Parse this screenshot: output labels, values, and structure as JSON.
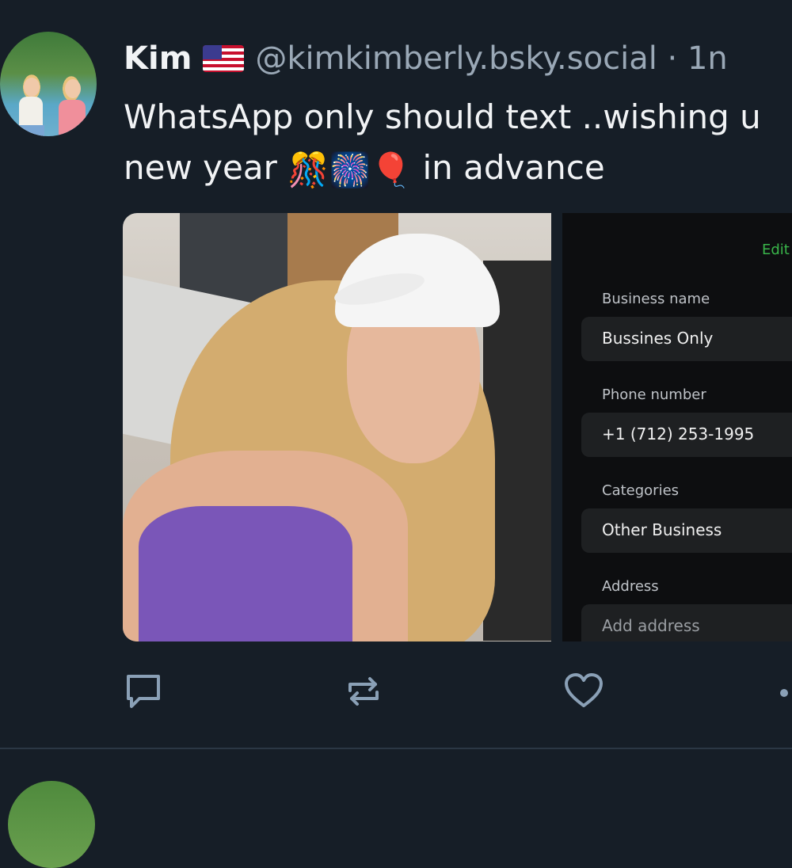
{
  "post": {
    "author_name": "Kim",
    "handle": "@kimkimberly.bsky.social",
    "time": "· 1n",
    "text_line1": "WhatsApp only should text ..wishing u",
    "text_line2_start": "new year",
    "emojis": [
      "🎊",
      "🎆",
      "🎈"
    ],
    "text_line2_end": "in advance"
  },
  "screenshot": {
    "edit_label": "Edit",
    "fields": [
      {
        "label": "Business name",
        "value": "Bussines Only"
      },
      {
        "label": "Phone number",
        "value": "+1 (712) 253-1995"
      },
      {
        "label": "Categories",
        "value": "Other Business"
      },
      {
        "label": "Address",
        "value": "Add address"
      }
    ]
  },
  "actions": {
    "icons": [
      "reply-icon",
      "repost-icon",
      "like-icon",
      "more-icon"
    ]
  },
  "colors": {
    "background": "#161e27",
    "handle": "#9aa8b6",
    "icon": "#8aa0b6",
    "edit": "#39b54a"
  }
}
